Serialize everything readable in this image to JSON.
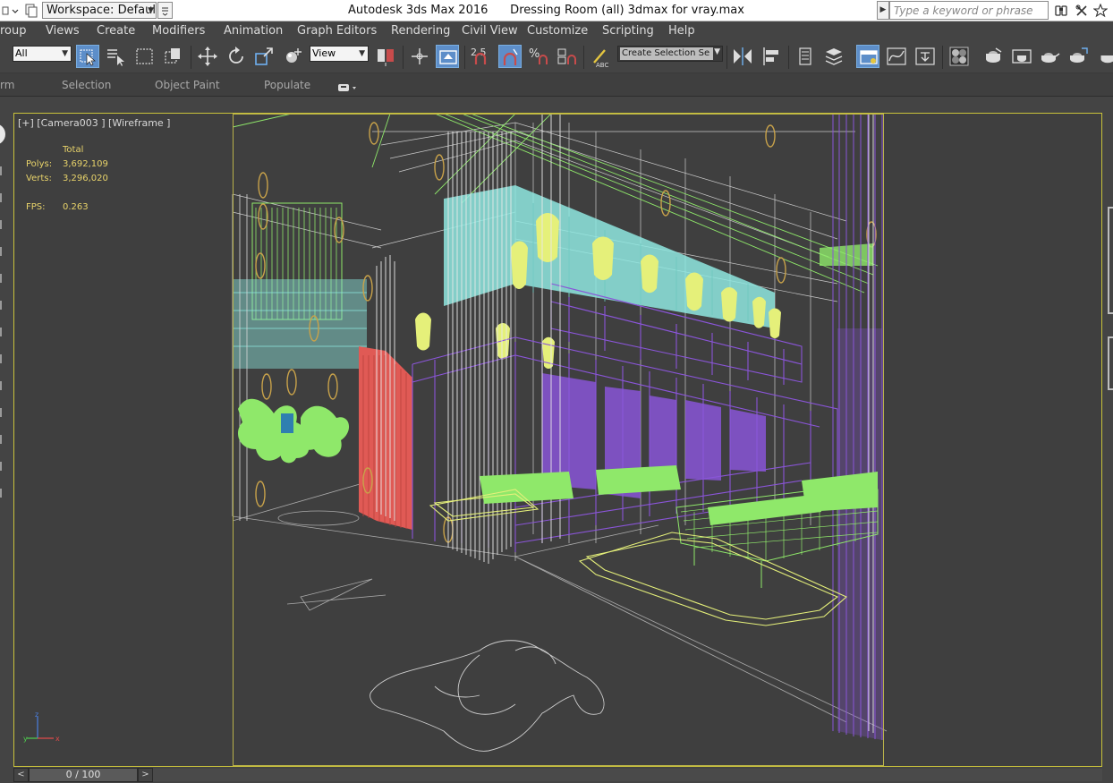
{
  "window": {
    "title": "Autodesk 3ds Max 2016      Dressing Room (all) 3dmax for vray.max"
  },
  "workspace": {
    "label": "Workspace: Default"
  },
  "search": {
    "placeholder": "Type a keyword or phrase"
  },
  "menu": {
    "items": [
      "roup",
      "Views",
      "Create",
      "Modifiers",
      "Animation",
      "Graph Editors",
      "Rendering",
      "Civil View",
      "Customize",
      "Scripting",
      "Help"
    ]
  },
  "toolbar": {
    "selection_filter": "All",
    "reference_coord": "View",
    "snap_value": "2.5",
    "named_selection_placeholder": "Create Selection Se"
  },
  "ribbon": {
    "tabs": [
      "rm",
      "Selection",
      "Object Paint",
      "Populate"
    ]
  },
  "viewport": {
    "label": "[+] [Camera003 ] [Wireframe ]",
    "stats": {
      "total_label": "Total",
      "polys_label": "Polys:",
      "polys_value": "3,692,109",
      "verts_label": "Verts:",
      "verts_value": "3,296,020",
      "fps_label": "FPS:",
      "fps_value": "0.263"
    },
    "frame_color": "#c9c23b"
  },
  "timeline": {
    "prev": "<",
    "frame": "0 / 100",
    "next": ">"
  },
  "colors": {
    "ui_bg": "#444444",
    "viewport_bg": "#3f3f3f",
    "stats_text": "#e8d36a",
    "wire_purple": "#8a55d8",
    "wire_green": "#8fe86a",
    "wire_cyan": "#8fe8e0",
    "wire_yellow": "#e5f07a",
    "wire_white": "#d9d9d9",
    "wire_red": "#e05a55",
    "wire_gold": "#c8a24a",
    "active_tool": "#5d8ec9"
  },
  "icons": {
    "title_left": [
      "down-arrow-icon",
      "quick-access-icon"
    ],
    "title_right": [
      "binoculars-icon",
      "tools-icon",
      "star-icon",
      "user-icon"
    ],
    "main_toolbar": [
      "select-object-icon",
      "select-by-name-icon",
      "rect-region-icon",
      "window-crossing-icon",
      "move-icon",
      "rotate-icon",
      "scale-icon",
      "place-icon",
      "mirror-icon",
      "use-pivot-icon",
      "select-manipulate-icon",
      "snap-toggle-icon",
      "angle-snap-icon",
      "percent-snap-icon",
      "spinner-snap-icon",
      "edit-named-selection-icon",
      "mirror-tool-icon",
      "align-icon",
      "layer-manager-icon",
      "scene-explorer-icon",
      "toggle-ribbon-icon",
      "curve-editor-icon",
      "schematic-view-icon",
      "material-editor-icon",
      "render-setup-icon",
      "rendered-frame-icon",
      "render-production-icon",
      "render-iterative-icon",
      "active-shade-icon"
    ]
  }
}
